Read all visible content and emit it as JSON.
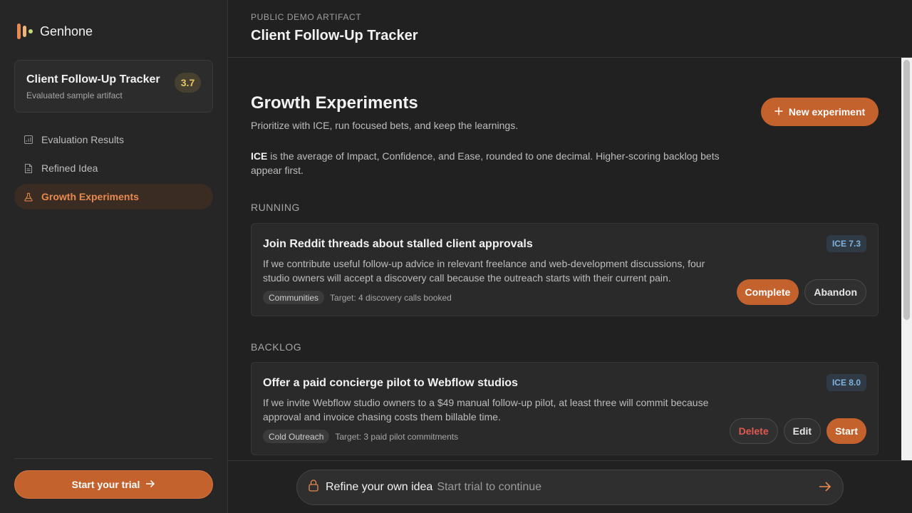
{
  "brand": {
    "name": "Genhone"
  },
  "sidebar": {
    "artifact": {
      "title": "Client Follow-Up Tracker",
      "subtitle": "Evaluated sample artifact",
      "score": "3.7"
    },
    "items": [
      {
        "label": "Evaluation Results",
        "icon": "chart-icon"
      },
      {
        "label": "Refined Idea",
        "icon": "document-icon"
      },
      {
        "label": "Growth Experiments",
        "icon": "flask-icon",
        "active": true
      }
    ],
    "trial_label": "Start your trial"
  },
  "header": {
    "eyebrow": "PUBLIC DEMO ARTIFACT",
    "title": "Client Follow-Up Tracker"
  },
  "main": {
    "title": "Growth Experiments",
    "subtitle": "Prioritize with ICE, run focused bets, and keep the learnings.",
    "ice_term": "ICE",
    "ice_note": " is the average of Impact, Confidence, and Ease, rounded to one decimal. Higher-scoring backlog bets appear first.",
    "new_button": "New experiment",
    "sections": {
      "running": "RUNNING",
      "backlog": "BACKLOG"
    },
    "running": [
      {
        "title": "Join Reddit threads about stalled client approvals",
        "description": "If we contribute useful follow-up advice in relevant freelance and web-development discussions, four studio owners will accept a discovery call because the outreach starts with their current pain.",
        "tag": "Communities",
        "target": "Target: 4 discovery calls booked",
        "ice": "ICE 7.3",
        "actions": {
          "complete": "Complete",
          "abandon": "Abandon"
        }
      }
    ],
    "backlog": [
      {
        "title": "Offer a paid concierge pilot to Webflow studios",
        "description": "If we invite Webflow studio owners to a $49 manual follow-up pilot, at least three will commit because approval and invoice chasing costs them billable time.",
        "tag": "Cold Outreach",
        "target": "Target: 3 paid pilot commitments",
        "ice": "ICE 8.0",
        "actions": {
          "delete": "Delete",
          "edit": "Edit",
          "start": "Start"
        }
      }
    ]
  },
  "refine": {
    "label": "Refine your own idea",
    "placeholder": "Start trial to continue"
  },
  "colors": {
    "accent": "#c4622d",
    "accent_text": "#e8894f",
    "score": "#e9c46a",
    "ice": "#7fb2dd",
    "danger": "#e05a52"
  }
}
